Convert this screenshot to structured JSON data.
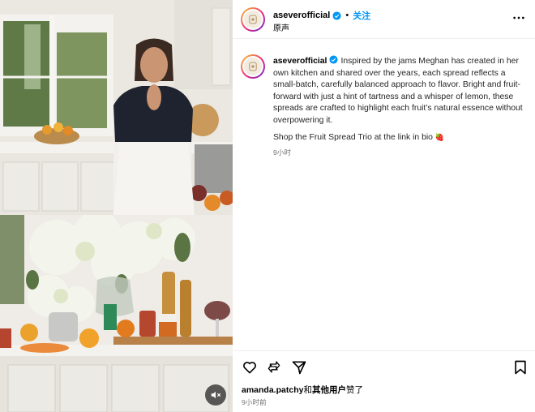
{
  "account": {
    "username": "aseverofficial",
    "verified": true,
    "follow_label": "关注",
    "separator": "•",
    "subtitle": "原声"
  },
  "caption": {
    "username": "aseverofficial",
    "text": "Inspired by the jams Meghan has created in her own kitchen and shared over the years, each spread reflects a small-batch, carefully balanced approach to flavor. Bright and fruit-forward with just a hint of tartness and a whisper of lemon, these spreads are crafted to highlight each fruit’s natural essence without overpowering it.",
    "shop_line": "Shop the Fruit Spread Trio at the link in bio",
    "shop_emoji": "🍓",
    "time": "9小时"
  },
  "engagement": {
    "liker": "amanda.patchy",
    "liker_joiner": "和",
    "others": "其他用户",
    "liked_suffix": "赞了",
    "time": "9小时前"
  },
  "icons": {
    "like": "heart-icon",
    "comment": "comment-icon",
    "share": "share-icon",
    "save": "bookmark-icon",
    "more": "more-options-icon",
    "mute": "muted-speaker-icon",
    "verified": "verified-badge-icon"
  },
  "colors": {
    "accent": "#0095f6",
    "verified": "#0095f6",
    "muted_text": "#737373",
    "border": "#efefef"
  }
}
